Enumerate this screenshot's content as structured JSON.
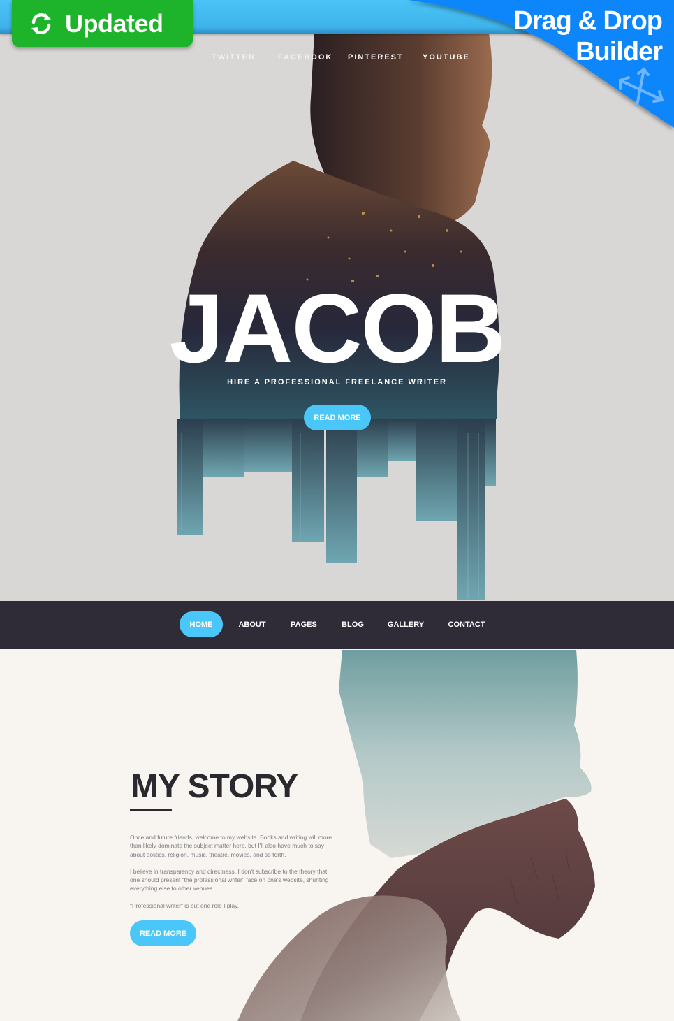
{
  "promo": {
    "updated_badge": {
      "label": "Updated",
      "icon": "refresh-icon",
      "color": "#1db32a"
    },
    "drag_drop": {
      "line1": "Drag & Drop",
      "line2": "Builder",
      "icon": "move-arrows-icon",
      "color": "#1185fb"
    }
  },
  "hero": {
    "social_links": [
      {
        "label": "TWITTER"
      },
      {
        "label": "FACEBOOK"
      },
      {
        "label": "PINTEREST"
      },
      {
        "label": "YOUTUBE"
      }
    ],
    "title": "JACOB",
    "subtitle": "HIRE A PROFESSIONAL FREELANCE WRITER",
    "cta_label": "READ MORE"
  },
  "main_nav": {
    "items": [
      {
        "label": "HOME",
        "active": true
      },
      {
        "label": "ABOUT",
        "active": false
      },
      {
        "label": "PAGES",
        "active": false
      },
      {
        "label": "BLOG",
        "active": false
      },
      {
        "label": "GALLERY",
        "active": false
      },
      {
        "label": "CONTACT",
        "active": false
      }
    ]
  },
  "story": {
    "title": "MY STORY",
    "paragraphs": [
      "Once and future friends, welcome to my website. Books and writing will more than likely dominate the subject matter here, but I'll also have much to say about politics, religion, music, theatre, movies, and so forth.",
      "I believe in transparency and directness. I don't subscribe to the theory that one should present \"the professional writer\" face on one's website, shunting everything else to other venues.",
      "\"Professional writer\" is but one role I play."
    ],
    "cta_label": "READ MORE"
  },
  "colors": {
    "accent": "#4ac7f8",
    "nav_bg": "#2f2c38",
    "page_bg": "#f8f5f0",
    "hero_bg": "#d8d7d5",
    "heading": "#2a2930"
  }
}
